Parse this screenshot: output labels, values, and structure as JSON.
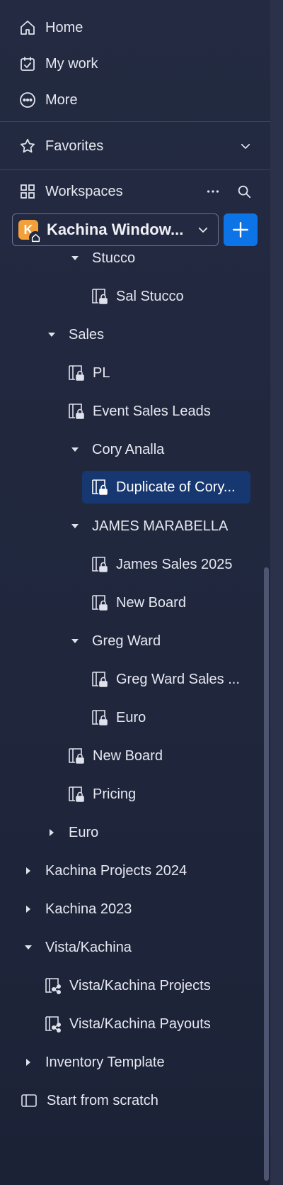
{
  "nav": {
    "home": "Home",
    "my_work": "My work",
    "more": "More",
    "favorites": "Favorites",
    "workspaces": "Workspaces"
  },
  "workspace": {
    "avatar_letter": "K",
    "name": "Kachina Window...",
    "add_label": "+"
  },
  "tree": {
    "stucco": "Stucco",
    "sal_stucco": "Sal Stucco",
    "sales": "Sales",
    "pl": "PL",
    "event_sales_leads": "Event Sales Leads",
    "cory_analla": "Cory Analla",
    "duplicate_of_cory": "Duplicate of Cory...",
    "james_marabella": "JAMES MARABELLA",
    "james_sales_2025": "James Sales 2025",
    "new_board_1": "New Board",
    "greg_ward": "Greg Ward",
    "greg_ward_sales": "Greg Ward Sales ...",
    "euro_board": "Euro",
    "new_board_2": "New Board",
    "pricing": "Pricing",
    "euro_folder": "Euro",
    "kachina_projects_2024": "Kachina Projects 2024",
    "kachina_2023": "Kachina 2023",
    "vista_kachina": "Vista/Kachina",
    "vista_kachina_projects": "Vista/Kachina Projects",
    "vista_kachina_payouts": "Vista/Kachina Payouts",
    "inventory_template": "Inventory Template",
    "start_from_scratch": "Start from scratch"
  },
  "colors": {
    "background": "#20273d",
    "accent": "#0d74e8",
    "selected": "#173771",
    "avatar": "#f4a03a"
  }
}
